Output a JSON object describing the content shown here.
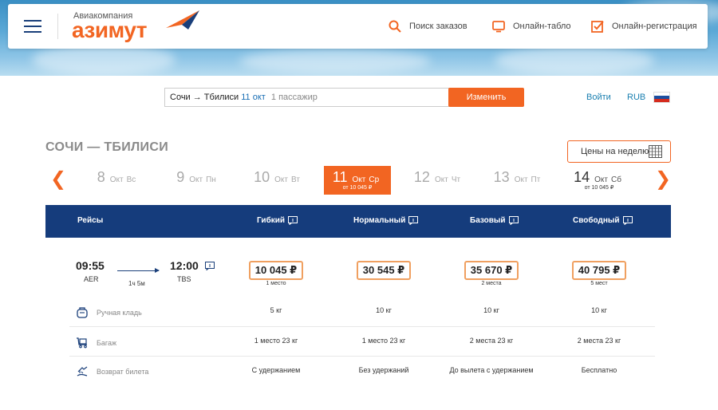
{
  "header": {
    "logo_small": "Авиакомпания",
    "logo_big": "азимут",
    "nav": [
      {
        "label": "Поиск заказов",
        "icon": "search-icon"
      },
      {
        "label": "Онлайн-табло",
        "icon": "monitor-icon"
      },
      {
        "label": "Онлайн-регистрация",
        "icon": "checkbox-icon"
      }
    ]
  },
  "search": {
    "route": "Сочи → Тбилиси",
    "date": "11 окт",
    "passengers": "1 пассажир",
    "change_label": "Изменить"
  },
  "toplinks": {
    "login": "Войти",
    "currency": "RUB"
  },
  "route_title": "СОЧИ — ТБИЛИСИ",
  "week_button": "Цены на неделю",
  "dates": [
    {
      "num": "8",
      "month": "Окт",
      "weekday": "Вс",
      "price": ""
    },
    {
      "num": "9",
      "month": "Окт",
      "weekday": "Пн",
      "price": ""
    },
    {
      "num": "10",
      "month": "Окт",
      "weekday": "Вт",
      "price": ""
    },
    {
      "num": "11",
      "month": "Окт",
      "weekday": "Ср",
      "price": "от 10 045 ₽"
    },
    {
      "num": "12",
      "month": "Окт",
      "weekday": "Чт",
      "price": ""
    },
    {
      "num": "13",
      "month": "Окт",
      "weekday": "Пт",
      "price": ""
    },
    {
      "num": "14",
      "month": "Окт",
      "weekday": "Сб",
      "price": "от 10 045 ₽"
    }
  ],
  "table": {
    "flights_label": "Рейсы",
    "fares": [
      "Гибкий",
      "Нормальный",
      "Базовый",
      "Свободный"
    ]
  },
  "flight": {
    "dep_time": "09:55",
    "dep_code": "AER",
    "arr_time": "12:00",
    "arr_code": "TBS",
    "duration": "1ч 5м",
    "prices": [
      {
        "price": "10 045 ₽",
        "seats": "1 место"
      },
      {
        "price": "30 545 ₽",
        "seats": ""
      },
      {
        "price": "35 670 ₽",
        "seats": "2 места"
      },
      {
        "price": "40 795 ₽",
        "seats": "5 мест"
      }
    ]
  },
  "features": [
    {
      "label": "Ручная кладь",
      "icon": "bag-icon",
      "values": [
        "5 кг",
        "10 кг",
        "10 кг",
        "10 кг"
      ]
    },
    {
      "label": "Багаж",
      "icon": "luggage-icon",
      "values": [
        "1 место 23 кг",
        "1 место 23 кг",
        "2 места 23 кг",
        "2 места 23 кг"
      ]
    },
    {
      "label": "Возврат билета",
      "icon": "refund-icon",
      "values": [
        "С удержанием",
        "Без удержаний",
        "До вылета с удержанием",
        "Бесплатно"
      ]
    }
  ],
  "colors": {
    "accent": "#f26522",
    "navy": "#153c7c",
    "link": "#1a7fb0"
  }
}
